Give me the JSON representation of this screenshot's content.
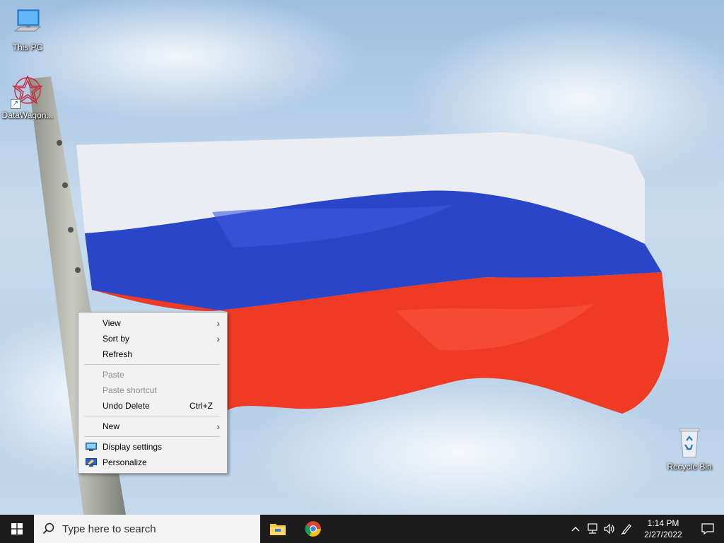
{
  "desktop": {
    "icons": [
      {
        "label": "This PC",
        "icon": "computer-icon"
      },
      {
        "label": "DataWagon...",
        "icon": "datawagon-app-icon"
      },
      {
        "label": "Recycle Bin",
        "icon": "recycle-bin-icon"
      }
    ]
  },
  "context_menu": {
    "items": [
      {
        "label": "View",
        "submenu": true
      },
      {
        "label": "Sort by",
        "submenu": true
      },
      {
        "label": "Refresh"
      },
      {
        "label": "Paste",
        "disabled": true
      },
      {
        "label": "Paste shortcut",
        "disabled": true
      },
      {
        "label": "Undo Delete",
        "shortcut": "Ctrl+Z"
      },
      {
        "label": "New",
        "submenu": true
      },
      {
        "label": "Display settings",
        "icon": "display-settings-icon"
      },
      {
        "label": "Personalize",
        "icon": "personalize-icon"
      }
    ]
  },
  "taskbar": {
    "search_placeholder": "Type here to search",
    "apps": [
      "file-explorer-icon",
      "chrome-icon"
    ],
    "tray_icons": [
      "chevron-up-icon",
      "network-icon",
      "volume-icon",
      "pen-icon"
    ],
    "clock": {
      "time": "1:14 PM",
      "date": "2/27/2022"
    },
    "notification_icon": "notification-icon"
  },
  "colors": {
    "taskbar": "#1c1c1c",
    "menu_bg": "#f2f2f2",
    "flag_white": "#ececf0",
    "flag_blue": "#2a46c8",
    "flag_red": "#ef3b24"
  }
}
